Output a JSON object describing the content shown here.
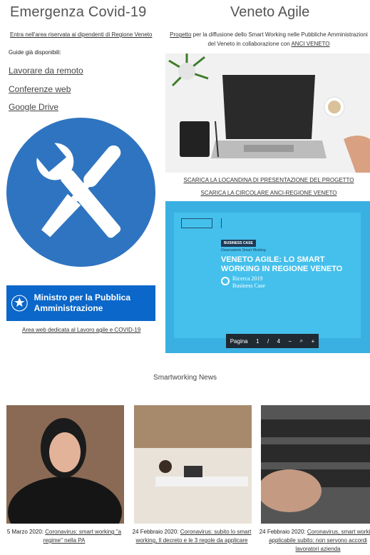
{
  "left": {
    "title": "Emergenza Covid-19",
    "reserved_link": "Entra nell'area riservata ai dipendenti di Regione Veneto",
    "guides_label": "Guide già disponibili:",
    "menu": [
      "Lavorare da remoto",
      "Conferenze web",
      "Google Drive"
    ],
    "ministry_logo": "Ministro per la Pubblica Amministrazione",
    "ministry_link": "Area web dedicata al Lavoro agile e COVID-19"
  },
  "right": {
    "title": "Veneto Agile",
    "desc_link": "Progetto",
    "desc_text": " per la diffusione dello Smart Working nelle Pubbliche Amministrazioni del Veneto  in collaborazione con ",
    "desc_link2": "ANCI VENETO",
    "link_locandina": "SCARICA LA LOCANDINA DI PRESENTAZIONE DEL PROGETTO",
    "link_circolare": "SCARICA LA CIRCOLARE ANCI-REGIONE VENETO",
    "doc": {
      "badge": "BUSINESS CASE",
      "subtitle": "Osservatorio Smart Working",
      "title": "VENETO AGILE: LO SMART WORKING IN REGIONE VENETO",
      "study1": "Ricerca 2019",
      "study2": "Business Case",
      "toolbar": {
        "page_label": "Pagina",
        "page": "1",
        "sep": "/",
        "total": "4"
      }
    }
  },
  "news": {
    "heading": "Smartworking News",
    "items": [
      {
        "date": "5 Marzo 2020: ",
        "link": "Coronavirus: smart working \"a regime\" nella PA"
      },
      {
        "date": "24 Febbraio 2020: ",
        "link": "Coronavirus: subito lo smart working, Il decreto e le 3 regole da applicare"
      },
      {
        "date": "24 Febbraio 2020: ",
        "link": "Coronavirus, smart working applicabile subito: non servono accordi lavoratori azienda"
      }
    ]
  },
  "colors": {
    "circle": "#2f74c0",
    "ministry": "#0b67c9",
    "doc": "#3ab0e2"
  }
}
